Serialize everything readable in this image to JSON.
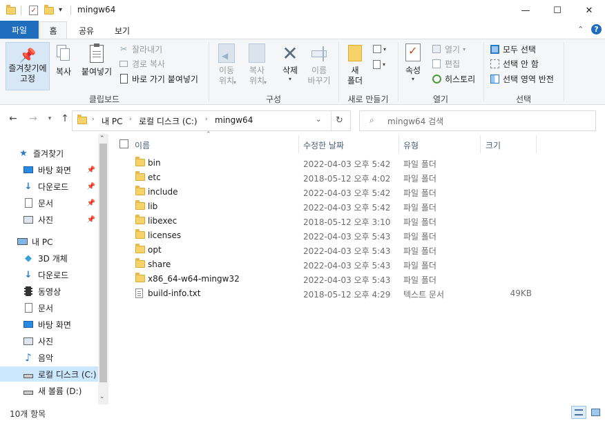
{
  "window": {
    "title": "mingw64",
    "minimize": "—",
    "maximize": "☐",
    "close": "✕"
  },
  "ribbon_tabs": [
    "파일",
    "홈",
    "공유",
    "보기"
  ],
  "ribbon": {
    "clipboard": {
      "pin_label_1": "즐겨찾기에",
      "pin_label_2": "고정",
      "copy_label": "복사",
      "paste_label": "붙여넣기",
      "cut_label": "잘라내기",
      "copy_path_label": "경로 복사",
      "paste_shortcut_label": "바로 가기 붙여넣기",
      "group_label": "클립보드"
    },
    "organize": {
      "move_label_1": "이동",
      "move_label_2": "위치",
      "copyto_label_1": "복사",
      "copyto_label_2": "위치",
      "delete_label": "삭제",
      "rename_label_1": "이름",
      "rename_label_2": "바꾸기",
      "group_label": "구성"
    },
    "new": {
      "new_folder_label_1": "새",
      "new_folder_label_2": "폴더",
      "group_label": "새로 만들기"
    },
    "open": {
      "properties_label": "속성",
      "open_label": "열기",
      "edit_label": "편집",
      "history_label": "히스토리",
      "group_label": "열기"
    },
    "select": {
      "select_all_label": "모두 선택",
      "select_none_label": "선택 안 함",
      "invert_label": "선택 영역 반전",
      "group_label": "선택"
    }
  },
  "address": {
    "crumbs": [
      "내 PC",
      "로컬 디스크 (C:)",
      "mingw64"
    ],
    "search_placeholder": "mingw64 검색"
  },
  "nav_pane": {
    "quick_access": "즐겨찾기",
    "quick_items": [
      "바탕 화면",
      "다운로드",
      "문서",
      "사진"
    ],
    "this_pc": "내 PC",
    "pc_items": [
      "3D 개체",
      "다운로드",
      "동영상",
      "문서",
      "바탕 화면",
      "사진",
      "음악",
      "로컬 디스크 (C:)",
      "새 볼륨 (D:)"
    ]
  },
  "columns": {
    "name": "이름",
    "date": "수정한 날짜",
    "type": "유형",
    "size": "크기"
  },
  "files": [
    {
      "name": "bin",
      "date": "2022-04-03 오후 5:42",
      "type": "파일 폴더",
      "size": "",
      "icon": "folder-icon"
    },
    {
      "name": "etc",
      "date": "2018-05-12 오후 4:02",
      "type": "파일 폴더",
      "size": "",
      "icon": "folder-icon"
    },
    {
      "name": "include",
      "date": "2022-04-03 오후 5:42",
      "type": "파일 폴더",
      "size": "",
      "icon": "folder-icon"
    },
    {
      "name": "lib",
      "date": "2022-04-03 오후 5:42",
      "type": "파일 폴더",
      "size": "",
      "icon": "folder-icon"
    },
    {
      "name": "libexec",
      "date": "2018-05-12 오후 3:10",
      "type": "파일 폴더",
      "size": "",
      "icon": "folder-icon"
    },
    {
      "name": "licenses",
      "date": "2022-04-03 오후 5:43",
      "type": "파일 폴더",
      "size": "",
      "icon": "folder-icon"
    },
    {
      "name": "opt",
      "date": "2022-04-03 오후 5:43",
      "type": "파일 폴더",
      "size": "",
      "icon": "folder-icon"
    },
    {
      "name": "share",
      "date": "2022-04-03 오후 5:43",
      "type": "파일 폴더",
      "size": "",
      "icon": "folder-icon"
    },
    {
      "name": "x86_64-w64-mingw32",
      "date": "2022-04-03 오후 5:43",
      "type": "파일 폴더",
      "size": "",
      "icon": "folder-icon"
    },
    {
      "name": "build-info.txt",
      "date": "2018-05-12 오후 4:29",
      "type": "텍스트 문서",
      "size": "49KB",
      "icon": "text-file-icon"
    }
  ],
  "status": {
    "item_count": "10개 항목"
  },
  "colors": {
    "accent": "#1e6ebd",
    "selection": "#cce8ff",
    "ribbon_bg": "#f5f6f7"
  }
}
